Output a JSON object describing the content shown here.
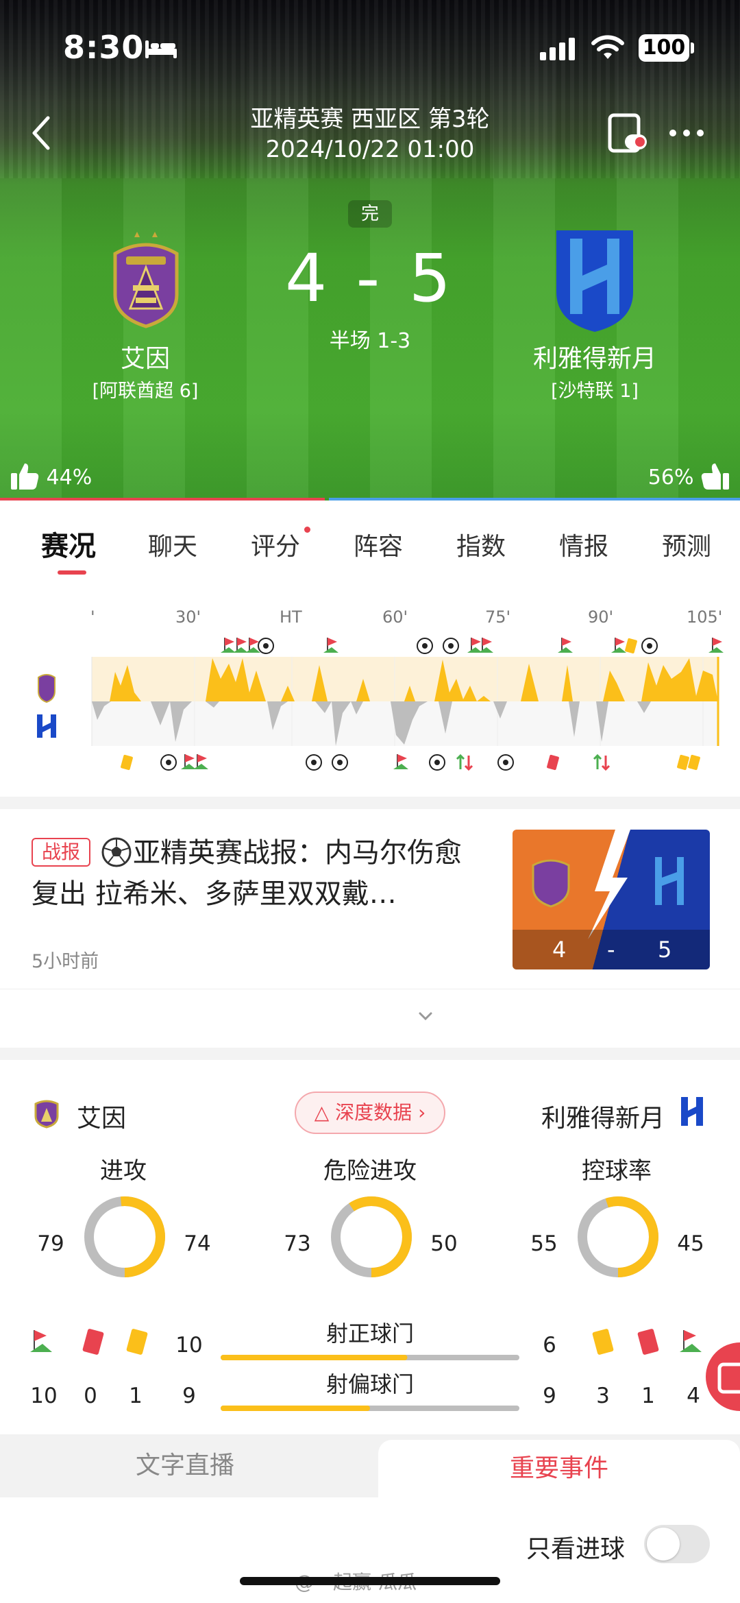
{
  "status_bar": {
    "time": "8:30",
    "battery": "100"
  },
  "header": {
    "league": "亚精英赛 西亚区 第3轮",
    "datetime": "2024/10/22 01:00"
  },
  "match": {
    "status": "完",
    "score": "4 - 5",
    "halftime": "半场 1-3",
    "home": {
      "name": "艾因",
      "league_rank": "[阿联酋超 6]",
      "vote": "44%",
      "color": "#7a3fa0"
    },
    "away": {
      "name": "利雅得新月",
      "league_rank": "[沙特联 1]",
      "vote": "56%",
      "color": "#1a49c8"
    }
  },
  "tabs": [
    {
      "label": "赛况",
      "active": true
    },
    {
      "label": "聊天"
    },
    {
      "label": "评分",
      "dot": true
    },
    {
      "label": "阵容"
    },
    {
      "label": "指数"
    },
    {
      "label": "情报"
    },
    {
      "label": "预测"
    }
  ],
  "timeline": {
    "ticks": [
      "'",
      "30'",
      "HT",
      "60'",
      "75'",
      "90'",
      "105'"
    ],
    "home_events": [
      "corner",
      "corner",
      "corner",
      "goal",
      "corner",
      "goal",
      "goal",
      "corner",
      "corner",
      "corner",
      "yellow-card",
      "goal",
      "corner"
    ],
    "away_events": [
      "yellow-card",
      "goal",
      "corner",
      "corner",
      "goal",
      "goal",
      "corner",
      "goal",
      "substitution",
      "goal",
      "red-card",
      "substitution",
      "yellow-card",
      "yellow-card"
    ]
  },
  "news": {
    "tag": "战报",
    "title": "亚精英赛战报：内马尔伤愈复出 拉希米、多萨里双双戴…",
    "time": "5小时前",
    "thumb_home": "4",
    "thumb_dash": "-",
    "thumb_away": "5"
  },
  "stats": {
    "home_name": "艾因",
    "away_name": "利雅得新月",
    "deep_data_label": "深度数据",
    "donuts": [
      {
        "title": "进攻",
        "home": "79",
        "away": "74"
      },
      {
        "title": "危险进攻",
        "home": "73",
        "away": "50"
      },
      {
        "title": "控球率",
        "home": "55",
        "away": "45"
      }
    ],
    "bars": [
      {
        "label": "射正球门",
        "home": "10",
        "away": "6"
      },
      {
        "label": "射偏球门",
        "home": "9",
        "away": "9"
      }
    ],
    "home_counts": {
      "corners": "10",
      "red": "0",
      "yellow": "1"
    },
    "away_counts": {
      "yellow": "3",
      "red": "1",
      "corners": "4"
    }
  },
  "bottom_tabs": {
    "left": "文字直播",
    "right": "重要事件"
  },
  "goal_filter": {
    "label": "只看进球"
  },
  "watermark": "@一起赢-瓜瓜",
  "colors": {
    "accent_red": "#e8434f",
    "accent_blue": "#4a9ee8",
    "stat_yellow": "#fbbf1a",
    "stat_gray": "#bdbdbd"
  }
}
